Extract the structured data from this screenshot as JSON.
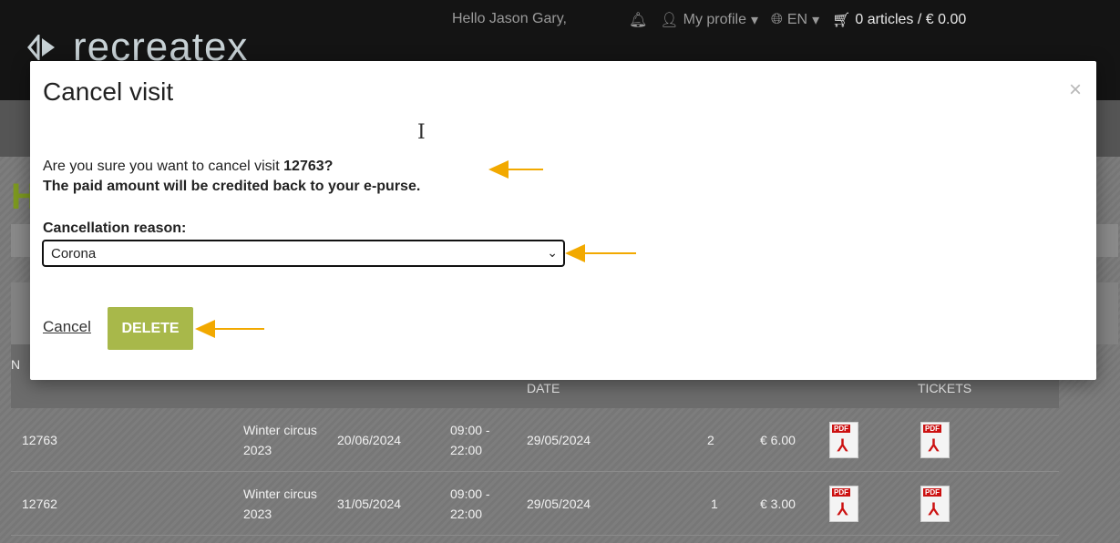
{
  "header": {
    "logo_text": "recreatex",
    "greeting": "Hello Jason Gary,",
    "profile_label": "My profile",
    "language": "EN",
    "cart_label": "0 articles / € 0.00"
  },
  "page": {
    "heading_initial": "H",
    "table": {
      "columns": [
        {
          "label": "N"
        },
        {
          "label": "DATE"
        },
        {
          "label": "TICKETS"
        }
      ],
      "rows": [
        {
          "number": "12763",
          "activity": "Winter circus 2023",
          "date": "20/06/2024",
          "time": "09:00 - 22:00",
          "order_date": "29/05/2024",
          "qty": "2",
          "amount": "€ 6.00"
        },
        {
          "number": "12762",
          "activity": "Winter circus 2023",
          "date": "31/05/2024",
          "time": "09:00 - 22:00",
          "order_date": "29/05/2024",
          "qty": "1",
          "amount": "€ 3.00"
        }
      ]
    }
  },
  "modal": {
    "title": "Cancel visit",
    "close_glyph": "×",
    "question_prefix": "Are you sure you want to cancel visit",
    "visit_number": "12763?",
    "credit_note": "The paid amount will be credited back to your e-purse.",
    "reason_label": "Cancellation reason:",
    "reason_selected": "Corona",
    "cancel_label": "Cancel",
    "delete_label": "DELETE"
  },
  "colors": {
    "accent_arrow": "#f2a900",
    "delete_button": "#a8b84a",
    "logo_green": "#7d9a1f"
  },
  "icons": [
    "bell-icon",
    "user-icon",
    "globe-icon",
    "cart-icon",
    "pdf-icon",
    "close-icon",
    "chevron-down-icon"
  ]
}
